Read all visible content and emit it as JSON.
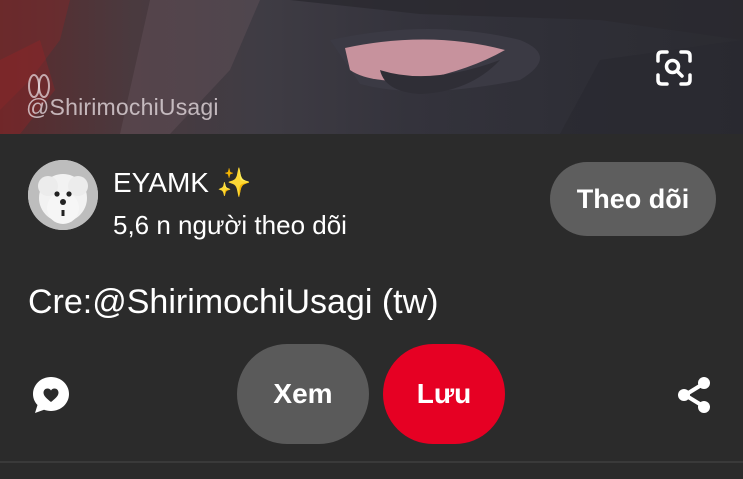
{
  "pin_image": {
    "watermark": "@ShirimochiUsagi"
  },
  "creator": {
    "name": "EYAMK ✨",
    "followers": "5,6 n người theo dõi",
    "follow_label": "Theo dõi"
  },
  "pin": {
    "title": "Cre:@ShirimochiUsagi (tw)"
  },
  "actions": {
    "view_label": "Xem",
    "save_label": "Lưu"
  },
  "icons": {
    "lens": "visual-search-icon",
    "comment": "comment-bubble-icon",
    "share": "share-icon"
  },
  "colors": {
    "background": "#2b2b2b",
    "save_button": "#e60023",
    "secondary_button": "#5e5e5e"
  }
}
